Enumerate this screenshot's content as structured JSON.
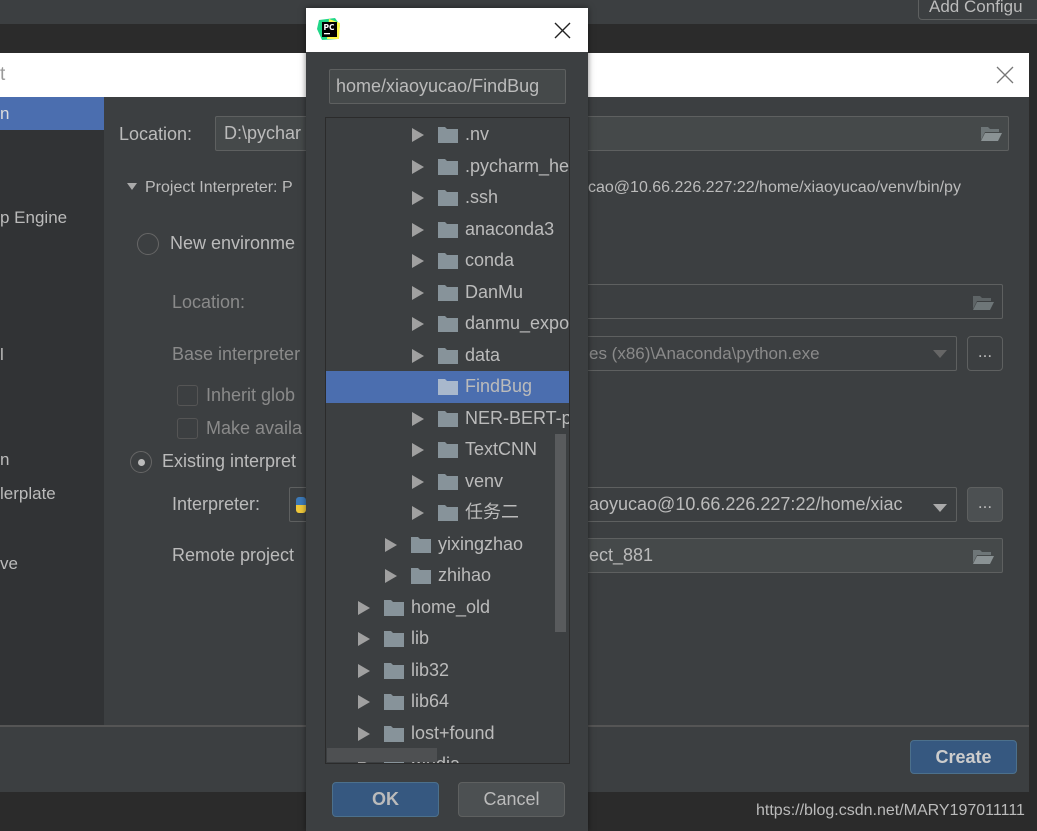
{
  "background": {
    "add_config_label": "Add Configu"
  },
  "new_project_dialog": {
    "title_fragment": "t",
    "sidebar": {
      "items": [
        {
          "label": "n",
          "selected": true
        },
        {
          "label": "p Engine"
        },
        {
          "label": "l"
        },
        {
          "label": "n"
        },
        {
          "label": "lerplate"
        },
        {
          "label": "ve"
        }
      ]
    },
    "location_label": "Location:",
    "location_value": "D:\\pychar",
    "project_interpreter_label": "Project Interpreter: P",
    "project_interpreter_path_tail": "cao@10.66.226.227:22/home/xiaoyucao/venv/bin/py",
    "new_env": {
      "label": "New environme",
      "selected": false,
      "location_label": "Location:",
      "base_interpreter_label": "Base interpreter",
      "base_interpreter_value": "es (x86)\\Anaconda\\python.exe",
      "inherit_label": "Inherit glob",
      "make_available_label": "Make availa"
    },
    "existing": {
      "label": "Existing interpret",
      "selected": true,
      "interpreter_label": "Interpreter:",
      "interpreter_value": "aoyucao@10.66.226.227:22/home/xiac",
      "remote_label": "Remote project",
      "remote_value": "ect_881"
    },
    "browse_label": "...",
    "create_label": "Create"
  },
  "file_chooser": {
    "path_value": "home/xiaoyucao/FindBug",
    "tree": [
      {
        "label": ".nv",
        "level": 3,
        "expandable": true
      },
      {
        "label": ".pycharm_he",
        "level": 3,
        "expandable": true
      },
      {
        "label": ".ssh",
        "level": 3,
        "expandable": true
      },
      {
        "label": "anaconda3",
        "level": 3,
        "expandable": true
      },
      {
        "label": "conda",
        "level": 3,
        "expandable": true
      },
      {
        "label": "DanMu",
        "level": 3,
        "expandable": true
      },
      {
        "label": "danmu_expo",
        "level": 3,
        "expandable": true
      },
      {
        "label": "data",
        "level": 3,
        "expandable": true
      },
      {
        "label": "FindBug",
        "level": 3,
        "expandable": false,
        "selected": true
      },
      {
        "label": "NER-BERT-p",
        "level": 3,
        "expandable": true
      },
      {
        "label": "TextCNN",
        "level": 3,
        "expandable": true
      },
      {
        "label": "venv",
        "level": 3,
        "expandable": true
      },
      {
        "label": "任务二",
        "level": 3,
        "expandable": true
      },
      {
        "label": "yixingzhao",
        "level": 2,
        "expandable": true
      },
      {
        "label": "zhihao",
        "level": 2,
        "expandable": true
      },
      {
        "label": "home_old",
        "level": 1,
        "expandable": true
      },
      {
        "label": "lib",
        "level": 1,
        "expandable": true
      },
      {
        "label": "lib32",
        "level": 1,
        "expandable": true
      },
      {
        "label": "lib64",
        "level": 1,
        "expandable": true
      },
      {
        "label": "lost+found",
        "level": 1,
        "expandable": true
      },
      {
        "label": "media",
        "level": 1,
        "expandable": true
      }
    ],
    "ok_label": "OK",
    "cancel_label": "Cancel"
  },
  "watermark": "https://blog.csdn.net/MARY197011111",
  "colors": {
    "accent": "#4b6eaf",
    "button": "#365880",
    "panel": "#3c3f41"
  }
}
